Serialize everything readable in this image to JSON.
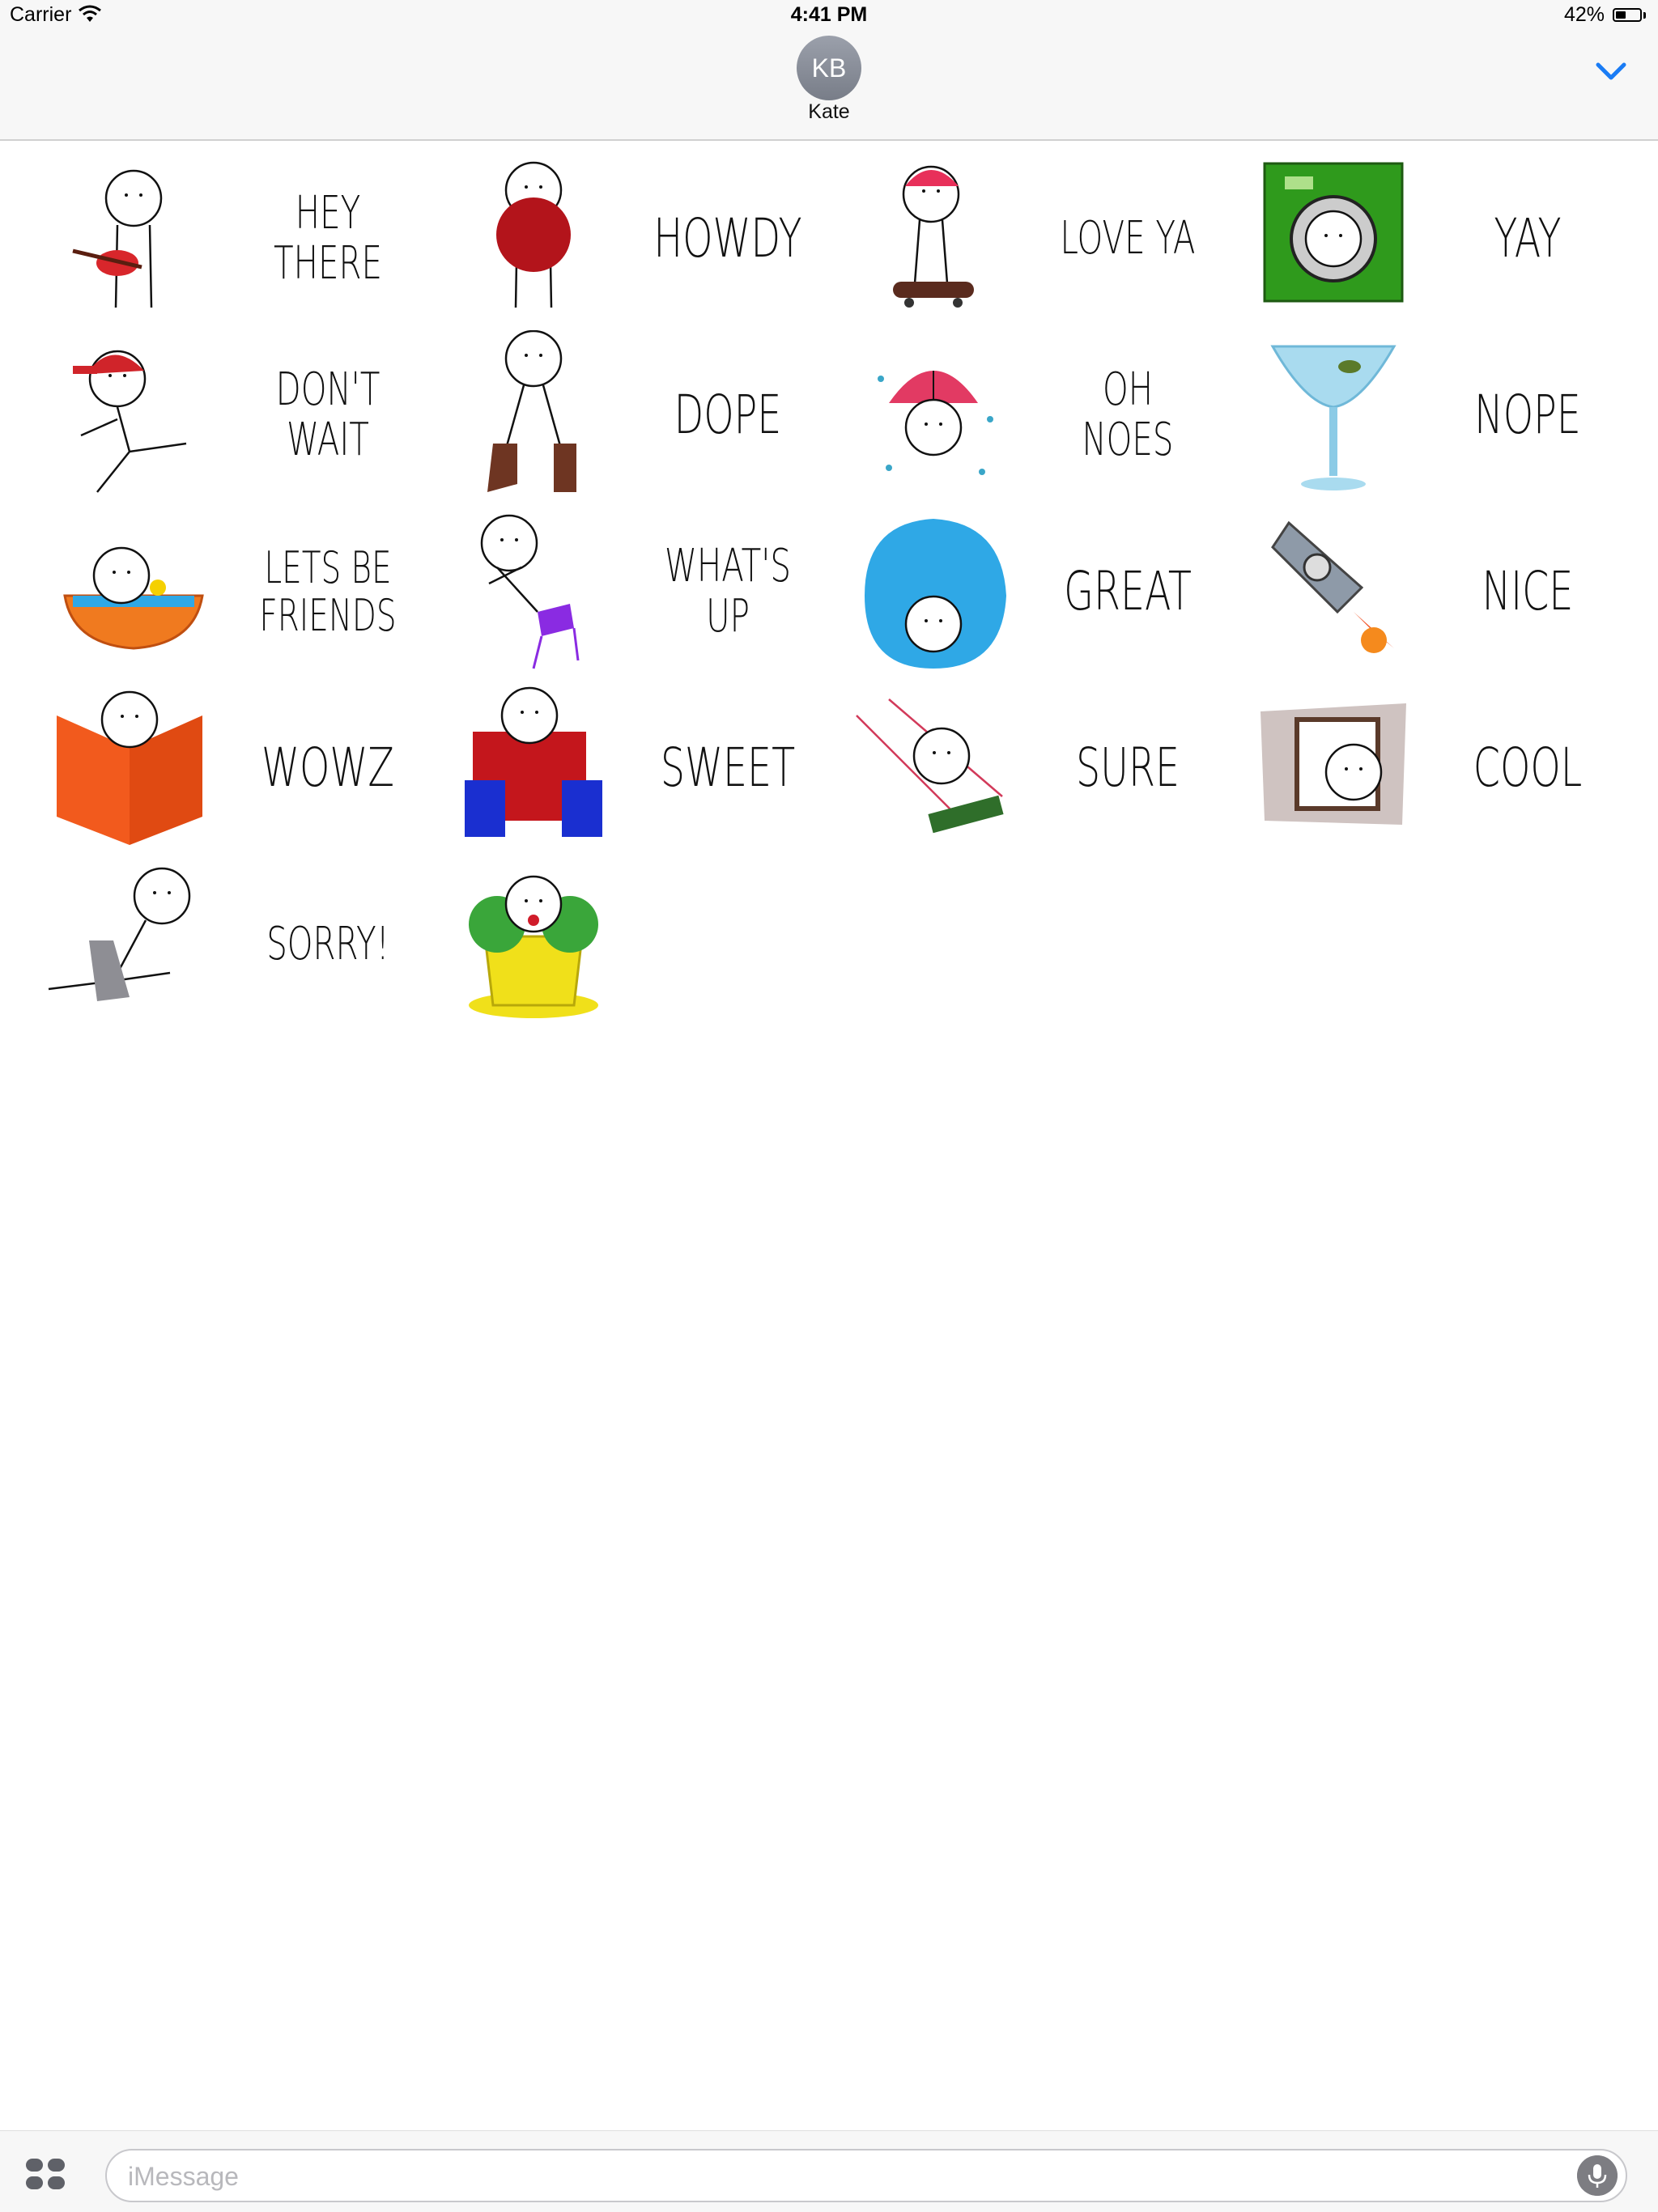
{
  "status_bar": {
    "carrier": "Carrier",
    "time": "4:41 PM",
    "battery": "42%",
    "battery_level": 0.42
  },
  "header": {
    "avatar_initials": "KB",
    "contact_name": "Kate",
    "collapse_icon": "chevron-down-icon"
  },
  "stickers": [
    {
      "label": "HEY THERE",
      "icon": "guitar-stick-figure",
      "color": "#d8262b"
    },
    {
      "label": "HOWDY",
      "icon": "red-ball-stick-figure",
      "color": "#b3141b"
    },
    {
      "label": "LOVE YA",
      "icon": "skateboard-stick-figure",
      "color": "#e8305a"
    },
    {
      "label": "YAY",
      "icon": "washing-machine",
      "color": "#2f9a1c"
    },
    {
      "label": "DON'T WAIT",
      "icon": "cap-running-stick-figure",
      "color": "#d0242a"
    },
    {
      "label": "DOPE",
      "icon": "boots-stick-figure",
      "color": "#6e3522"
    },
    {
      "label": "OH NOES",
      "icon": "umbrella-stick-figure",
      "color": "#e23a63"
    },
    {
      "label": "NOPE",
      "icon": "cocktail-glass",
      "color": "#a9dbef"
    },
    {
      "label": "LETS BE\nFRIENDS",
      "icon": "bathtub-stick-figure",
      "color": "#f07a1f"
    },
    {
      "label": "WHAT'S UP",
      "icon": "flying-chair-stick-figure",
      "color": "#8a2be2"
    },
    {
      "label": "GREAT",
      "icon": "water-blob-stick-figure",
      "color": "#2fa8e6"
    },
    {
      "label": "NICE",
      "icon": "rocket",
      "color": "#8e9aa8"
    },
    {
      "label": "WOWZ",
      "icon": "book-stick-figure",
      "color": "#f25a1d"
    },
    {
      "label": "SWEET",
      "icon": "armchair-stick-figure",
      "color": "#c4161c"
    },
    {
      "label": "SURE",
      "icon": "swing-stick-figure",
      "color": "#2f6e2a"
    },
    {
      "label": "COOL",
      "icon": "window-stick-figure",
      "color": "#cfc3c1"
    },
    {
      "label": "SORRY!",
      "icon": "laptop-stick-figure",
      "color": "#8e8e94"
    },
    {
      "label": "",
      "icon": "flower-pot-stick-figure",
      "color": "#f0e01a"
    }
  ],
  "bottom_bar": {
    "apps_icon": "app-drawer-icon",
    "placeholder": "iMessage",
    "mic_icon": "microphone-icon"
  }
}
